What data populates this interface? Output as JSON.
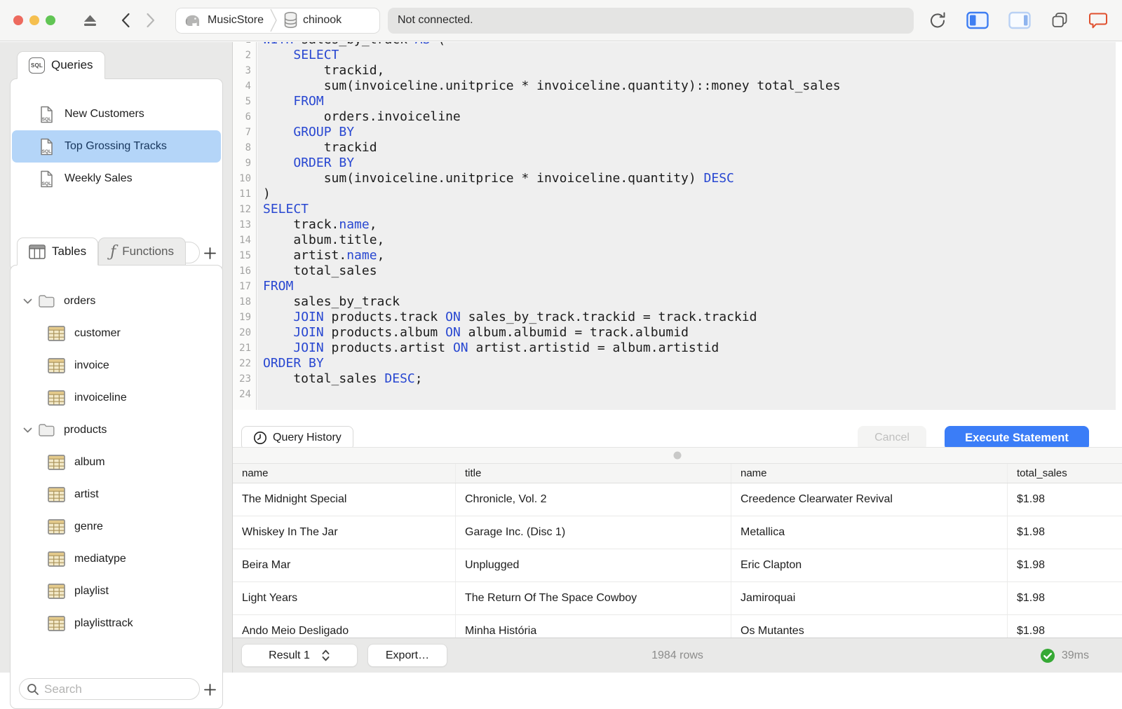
{
  "titlebar": {
    "breadcrumb": {
      "server": "MusicStore",
      "database": "chinook"
    },
    "status": "Not connected."
  },
  "sidebar": {
    "queries": {
      "tab": "Queries",
      "items": [
        {
          "label": "New Customers",
          "selected": false
        },
        {
          "label": "Top Grossing Tracks",
          "selected": true
        },
        {
          "label": "Weekly Sales",
          "selected": false
        }
      ],
      "search_placeholder": "Search"
    },
    "schema": {
      "tabs": {
        "tables": "Tables",
        "functions": "Functions"
      },
      "tree": [
        {
          "label": "orders",
          "kind": "folder",
          "expanded": true
        },
        {
          "label": "customer",
          "kind": "table"
        },
        {
          "label": "invoice",
          "kind": "table"
        },
        {
          "label": "invoiceline",
          "kind": "table"
        },
        {
          "label": "products",
          "kind": "folder",
          "expanded": true
        },
        {
          "label": "album",
          "kind": "table"
        },
        {
          "label": "artist",
          "kind": "table"
        },
        {
          "label": "genre",
          "kind": "table"
        },
        {
          "label": "mediatype",
          "kind": "table"
        },
        {
          "label": "playlist",
          "kind": "table"
        },
        {
          "label": "playlisttrack",
          "kind": "table"
        }
      ],
      "search_placeholder": "Search"
    }
  },
  "editor": {
    "history_button": "Query History",
    "cancel_button": "Cancel",
    "execute_button": "Execute Statement",
    "lines": [
      {
        "seg": [
          [
            "WITH",
            1
          ],
          [
            " sales_by_track ",
            0
          ],
          [
            "AS",
            1
          ],
          [
            " (",
            0
          ]
        ]
      },
      {
        "seg": [
          [
            "    ",
            0
          ],
          [
            "SELECT",
            1
          ]
        ]
      },
      {
        "seg": [
          [
            "        trackid,",
            0
          ]
        ]
      },
      {
        "seg": [
          [
            "        sum(invoiceline.unitprice * invoiceline.quantity)::money total_sales",
            0
          ]
        ]
      },
      {
        "seg": [
          [
            "    ",
            0
          ],
          [
            "FROM",
            1
          ]
        ]
      },
      {
        "seg": [
          [
            "        orders.invoiceline",
            0
          ]
        ]
      },
      {
        "seg": [
          [
            "    ",
            0
          ],
          [
            "GROUP BY",
            1
          ]
        ]
      },
      {
        "seg": [
          [
            "        trackid",
            0
          ]
        ]
      },
      {
        "seg": [
          [
            "    ",
            0
          ],
          [
            "ORDER BY",
            1
          ]
        ]
      },
      {
        "seg": [
          [
            "        sum(invoiceline.unitprice * invoiceline.quantity) ",
            0
          ],
          [
            "DESC",
            1
          ]
        ]
      },
      {
        "seg": [
          [
            ")",
            0
          ]
        ]
      },
      {
        "seg": [
          [
            "SELECT",
            1
          ]
        ]
      },
      {
        "seg": [
          [
            "    track.",
            0
          ],
          [
            "name",
            1
          ],
          [
            ",",
            0
          ]
        ]
      },
      {
        "seg": [
          [
            "    album.title,",
            0
          ]
        ]
      },
      {
        "seg": [
          [
            "    artist.",
            0
          ],
          [
            "name",
            1
          ],
          [
            ",",
            0
          ]
        ]
      },
      {
        "seg": [
          [
            "    total_sales",
            0
          ]
        ]
      },
      {
        "seg": [
          [
            "FROM",
            1
          ]
        ]
      },
      {
        "seg": [
          [
            "    sales_by_track",
            0
          ]
        ]
      },
      {
        "seg": [
          [
            "    ",
            0
          ],
          [
            "JOIN",
            1
          ],
          [
            " products.track ",
            0
          ],
          [
            "ON",
            1
          ],
          [
            " sales_by_track.trackid = track.trackid",
            0
          ]
        ]
      },
      {
        "seg": [
          [
            "    ",
            0
          ],
          [
            "JOIN",
            1
          ],
          [
            " products.album ",
            0
          ],
          [
            "ON",
            1
          ],
          [
            " album.albumid = track.albumid",
            0
          ]
        ]
      },
      {
        "seg": [
          [
            "    ",
            0
          ],
          [
            "JOIN",
            1
          ],
          [
            " products.artist ",
            0
          ],
          [
            "ON",
            1
          ],
          [
            " artist.artistid = album.artistid",
            0
          ]
        ]
      },
      {
        "seg": [
          [
            "ORDER BY",
            1
          ]
        ]
      },
      {
        "seg": [
          [
            "    total_sales ",
            0
          ],
          [
            "DESC",
            1
          ],
          [
            ";",
            0
          ]
        ]
      },
      {
        "seg": []
      }
    ]
  },
  "results": {
    "columns": [
      "name",
      "title",
      "name",
      "total_sales"
    ],
    "rows": [
      [
        "The Midnight Special",
        "Chronicle, Vol. 2",
        "Creedence Clearwater Revival",
        "$1.98"
      ],
      [
        "Whiskey In The Jar",
        "Garage Inc. (Disc 1)",
        "Metallica",
        "$1.98"
      ],
      [
        "Beira Mar",
        "Unplugged",
        "Eric Clapton",
        "$1.98"
      ],
      [
        "Light Years",
        "The Return Of The Space Cowboy",
        "Jamiroquai",
        "$1.98"
      ],
      [
        "Ando Meio Desligado",
        "Minha História",
        "Os Mutantes",
        "$1.98"
      ]
    ]
  },
  "statusbar": {
    "result_selector": "Result 1",
    "export_button": "Export…",
    "row_count": "1984 rows",
    "duration": "39ms"
  },
  "colors": {
    "accent": "#3b7df7",
    "selection": "#b4d5f8",
    "keyword": "#2847d1",
    "success": "#36a935",
    "chat_icon": "#e0502e"
  }
}
